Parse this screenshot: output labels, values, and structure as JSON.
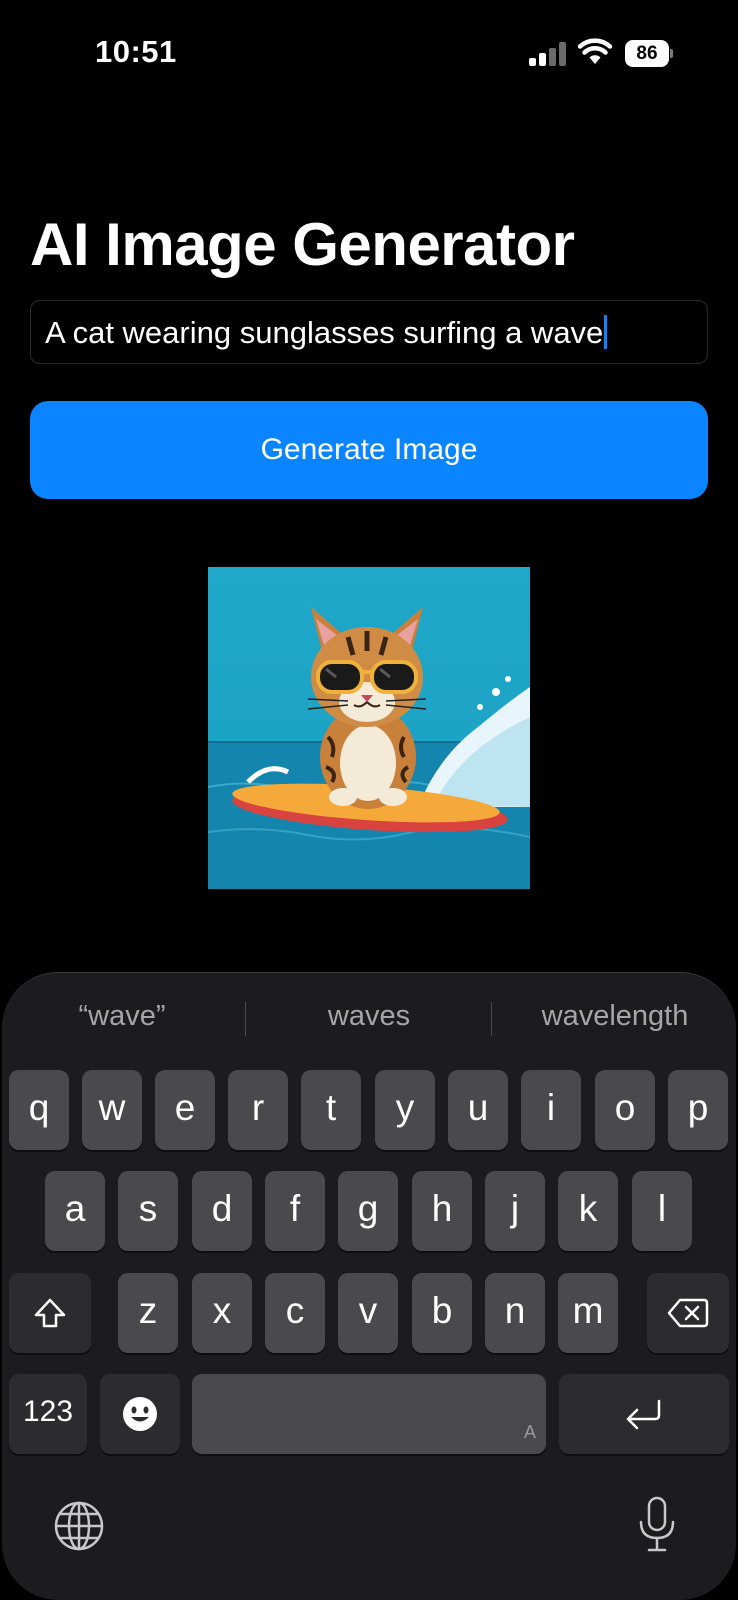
{
  "status_bar": {
    "time": "10:51",
    "battery": "86"
  },
  "main": {
    "title": "AI Image Generator",
    "prompt_value": "A cat wearing sunglasses surfing a wave",
    "generate_label": "Generate Image",
    "accent_color": "#0a84ff"
  },
  "keyboard": {
    "suggestions": [
      "“wave”",
      "waves",
      "wavelength"
    ],
    "row1": [
      "q",
      "w",
      "e",
      "r",
      "t",
      "y",
      "u",
      "i",
      "o",
      "p"
    ],
    "row2": [
      "a",
      "s",
      "d",
      "f",
      "g",
      "h",
      "j",
      "k",
      "l"
    ],
    "row3": [
      "z",
      "x",
      "c",
      "v",
      "b",
      "n",
      "m"
    ],
    "numbers_label": "123",
    "space_hint": "A",
    "icons": [
      "shift-icon",
      "delete-icon",
      "emoji-icon",
      "return-icon",
      "globe-icon",
      "microphone-icon"
    ]
  }
}
